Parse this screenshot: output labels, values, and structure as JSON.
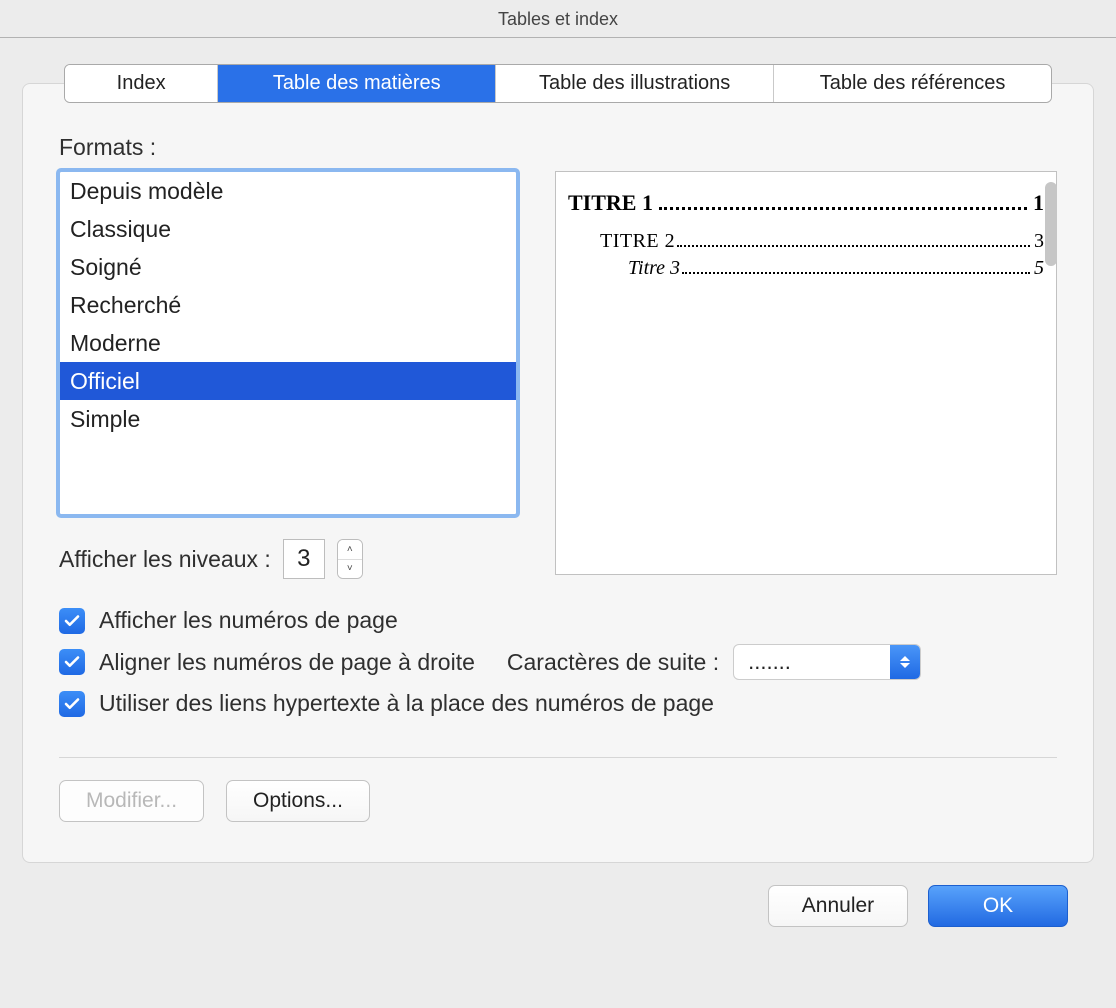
{
  "title": "Tables et index",
  "tabs": [
    {
      "label": "Index"
    },
    {
      "label": "Table des matières",
      "active": true
    },
    {
      "label": "Table des illustrations"
    },
    {
      "label": "Table des références"
    }
  ],
  "formats_label": "Formats :",
  "formats_items": [
    "Depuis modèle",
    "Classique",
    "Soigné",
    "Recherché",
    "Moderne",
    "Officiel",
    "Simple"
  ],
  "formats_selected": "Officiel",
  "levels_label": "Afficher les niveaux :",
  "levels_value": "3",
  "preview": {
    "line1": {
      "title": "TITRE 1",
      "page": "1"
    },
    "line2": {
      "title": "TITRE 2",
      "page": "3"
    },
    "line3": {
      "title": "Titre 3",
      "page": "5"
    }
  },
  "check_show_pages": "Afficher les numéros de page",
  "check_align_right": "Aligner les numéros de page à droite",
  "leader_label": "Caractères de suite :",
  "leader_value": ".......",
  "check_hyperlinks": "Utiliser des liens hypertexte à la place des numéros de page",
  "modify_button": "Modifier...",
  "options_button": "Options...",
  "cancel_button": "Annuler",
  "ok_button": "OK"
}
